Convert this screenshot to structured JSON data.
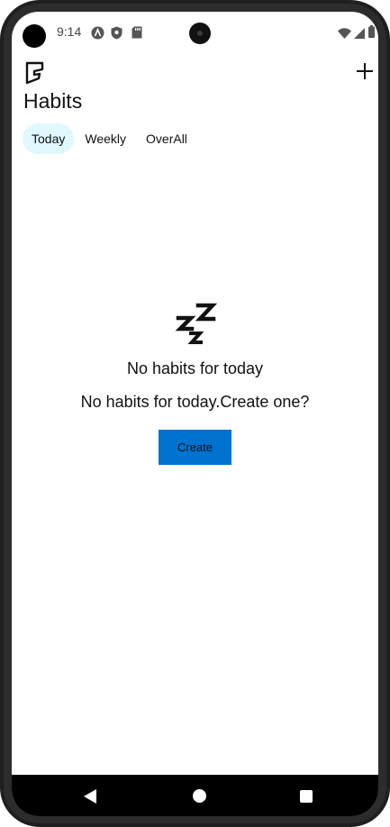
{
  "status_bar": {
    "time": "9:14",
    "icons": [
      "android-auto-icon",
      "shield-icon",
      "sd-card-icon",
      "wifi-icon",
      "signal-icon",
      "battery-icon"
    ]
  },
  "app_bar": {
    "logo_icon": "habit-logo-icon",
    "add_icon": "plus-icon"
  },
  "page": {
    "title": "Habits"
  },
  "tabs": [
    {
      "label": "Today",
      "active": true
    },
    {
      "label": "Weekly",
      "active": false
    },
    {
      "label": "OverAll",
      "active": false
    }
  ],
  "empty_state": {
    "icon": "sleep-zzz-icon",
    "title": "No habits for today",
    "subtitle": "No habits for today.Create one?",
    "button_label": "Create"
  },
  "navigation": {
    "icons": [
      "back-icon",
      "home-icon",
      "recents-icon"
    ]
  },
  "colors": {
    "active_tab_bg": "#dff9ff",
    "create_button_bg": "#0072d0",
    "nav_bar_bg": "#000000"
  }
}
